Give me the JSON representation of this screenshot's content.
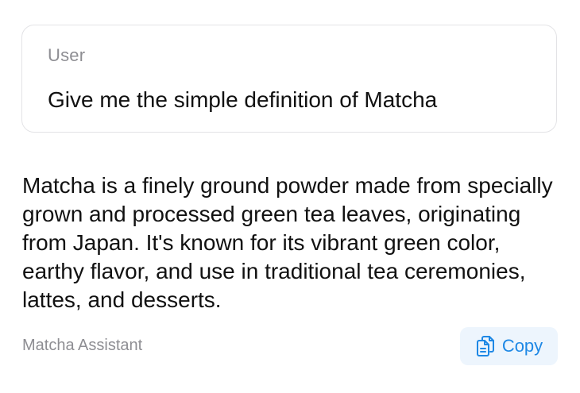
{
  "user_message": {
    "role_label": "User",
    "text": "Give me the simple definition of Matcha"
  },
  "assistant_message": {
    "text": "Matcha is a finely ground powder made from specially grown and processed green tea leaves, originating from Japan. It's known for its vibrant green color, earthy flavor, and use in traditional tea ceremonies, lattes, and desserts.",
    "assistant_name": "Matcha Assistant",
    "copy_button": {
      "label": "Copy",
      "icon": "copy-icon"
    }
  },
  "colors": {
    "accent": "#1e88e5",
    "copy_button_bg": "#edf5fd",
    "muted_text": "#8e8e93",
    "card_border": "#e3e3e6"
  }
}
